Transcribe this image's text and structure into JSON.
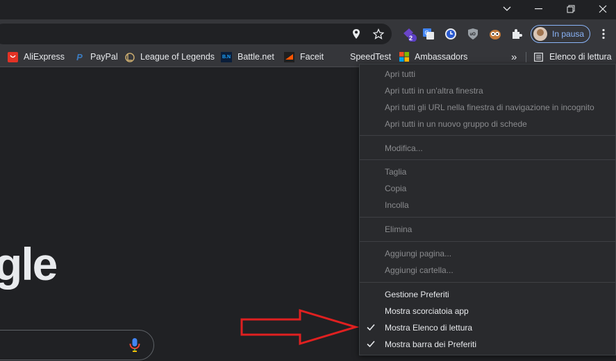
{
  "window": {
    "minimize_glyph": "—",
    "maximize_glyph": "❐",
    "close_glyph": "✕",
    "dropdown_glyph": "⌄"
  },
  "toolbar": {
    "extension_badge": "2",
    "profile_label": "In pausa",
    "kebab_glyph": "⋮"
  },
  "bookmarks": {
    "items": [
      {
        "label": "AliExpress",
        "icon": "aliexpress-icon"
      },
      {
        "label": "PayPal",
        "icon": "paypal-icon"
      },
      {
        "label": "League of Legends",
        "icon": "league-icon"
      },
      {
        "label": "Battle.net",
        "icon": "battlenet-icon"
      },
      {
        "label": "Faceit",
        "icon": "faceit-icon"
      },
      {
        "label": "SpeedTest",
        "icon": ""
      },
      {
        "label": "Ambassadors",
        "icon": "microsoft-icon"
      }
    ],
    "overflow_glyph": "»",
    "reading_list_label": "Elenco di lettura"
  },
  "page": {
    "logo_fragment": "gle"
  },
  "context_menu": {
    "items": [
      {
        "label": "Apri tutti",
        "enabled": false,
        "checked": false
      },
      {
        "label": "Apri tutti in un'altra finestra",
        "enabled": false,
        "checked": false
      },
      {
        "label": "Apri tutti gli URL nella finestra di navigazione in incognito",
        "enabled": false,
        "checked": false
      },
      {
        "label": "Apri tutti in un nuovo gruppo di schede",
        "enabled": false,
        "checked": false
      },
      {
        "label": "Modifica...",
        "enabled": false,
        "checked": false
      },
      {
        "label": "Taglia",
        "enabled": false,
        "checked": false
      },
      {
        "label": "Copia",
        "enabled": false,
        "checked": false
      },
      {
        "label": "Incolla",
        "enabled": false,
        "checked": false
      },
      {
        "label": "Elimina",
        "enabled": false,
        "checked": false
      },
      {
        "label": "Aggiungi pagina...",
        "enabled": false,
        "checked": false
      },
      {
        "label": "Aggiungi cartella...",
        "enabled": false,
        "checked": false
      },
      {
        "label": "Gestione Preferiti",
        "enabled": true,
        "checked": false
      },
      {
        "label": "Mostra scorciatoia app",
        "enabled": true,
        "checked": false
      },
      {
        "label": "Mostra Elenco di lettura",
        "enabled": true,
        "checked": true
      },
      {
        "label": "Mostra barra dei Preferiti",
        "enabled": true,
        "checked": true
      }
    ]
  },
  "colors": {
    "annotation_arrow": "#e02020",
    "accent": "#8ab4f8",
    "menu_bg": "#292a2d",
    "toolbar_bg": "#35363a",
    "page_bg": "#202124"
  }
}
